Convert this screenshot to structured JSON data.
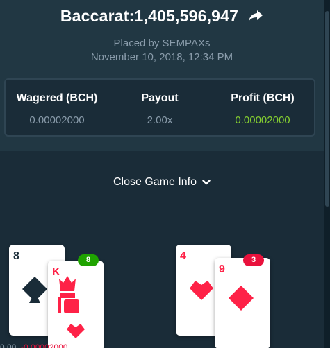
{
  "header": {
    "title": "Baccarat:1,405,596,947",
    "placed_by": "Placed by SEMPAXs",
    "date": "November 10, 2018, 12:34 PM"
  },
  "stats": {
    "wagered_label": "Wagered (BCH)",
    "wagered_value": "0.00002000",
    "payout_label": "Payout",
    "payout_value": "2.00x",
    "profit_label": "Profit (BCH)",
    "profit_value": "0.00002000"
  },
  "toggle": {
    "label": "Close Game Info"
  },
  "player_hand": {
    "score": "8",
    "cards": [
      {
        "rank": "8",
        "suit": "spades"
      },
      {
        "rank": "K",
        "suit": "hearts"
      }
    ]
  },
  "banker_hand": {
    "score": "3",
    "cards": [
      {
        "rank": "4",
        "suit": "hearts"
      },
      {
        "rank": "9",
        "suit": "diamonds"
      }
    ]
  },
  "colors": {
    "background": "#1a2c38",
    "panel": "#213743",
    "profit_green": "#86d130",
    "card_red": "#fe2247",
    "win_badge": "#1fa300",
    "lose_badge": "#e9113c"
  }
}
